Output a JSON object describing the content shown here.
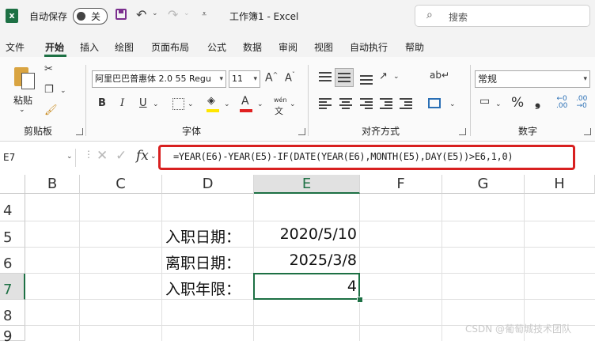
{
  "titlebar": {
    "logo_letter": "x",
    "autosave_label": "自动保存",
    "autosave_state": "关",
    "document_title": "工作簿1  -  Excel",
    "search_placeholder": "搜索"
  },
  "menu": {
    "tabs": [
      "文件",
      "开始",
      "插入",
      "绘图",
      "页面布局",
      "公式",
      "数据",
      "审阅",
      "视图",
      "自动执行",
      "帮助"
    ],
    "active_tab": "开始"
  },
  "ribbon": {
    "clipboard": {
      "paste_label": "粘贴",
      "group_label": "剪贴板"
    },
    "font": {
      "font_name": "阿里巴巴普惠体 2.0 55 Regu",
      "font_size": "11",
      "group_label": "字体",
      "bold": "B",
      "italic": "I",
      "underline": "U",
      "phonetic": "wén"
    },
    "alignment": {
      "group_label": "对齐方式"
    },
    "number": {
      "format": "常规",
      "group_label": "数字",
      "percent": "%",
      "comma": "❟"
    },
    "colors": {
      "accent": "#1d7044",
      "font_color_bar": "#e02020",
      "highlight_bar": "#ffe600",
      "formula_frame": "#d82020"
    }
  },
  "formula_bar": {
    "name_box": "E7",
    "fx": "fx",
    "formula": "=YEAR(E6)-YEAR(E5)-IF(DATE(YEAR(E6),MONTH(E5),DAY(E5))>E6,1,0)"
  },
  "grid": {
    "columns": [
      "B",
      "C",
      "D",
      "E",
      "F",
      "G",
      "H"
    ],
    "selected_column": "E",
    "rows": [
      "4",
      "5",
      "6",
      "7",
      "8",
      "9"
    ],
    "selected_row": "7",
    "cells": {
      "D5": "入职日期：",
      "E5": "2020/5/10",
      "D6": "离职日期：",
      "E6": "2025/3/8",
      "D7": "入职年限：",
      "E7": "4"
    }
  },
  "watermark": "CSDN @葡萄城技术团队"
}
